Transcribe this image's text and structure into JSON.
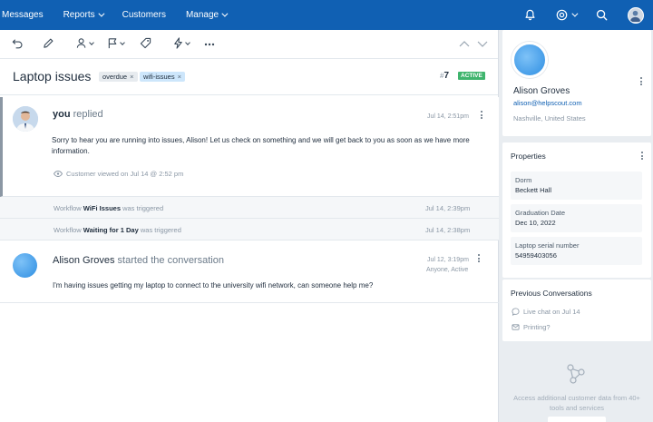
{
  "nav": {
    "items": [
      {
        "label": "Messages",
        "caret": false
      },
      {
        "label": "Reports",
        "caret": true
      },
      {
        "label": "Customers",
        "caret": false
      },
      {
        "label": "Manage",
        "caret": true
      }
    ],
    "icons": [
      "bell-icon",
      "lifebuoy-icon",
      "search-icon",
      "user-avatar"
    ]
  },
  "conversation": {
    "subject": "Laptop issues",
    "tags": [
      "overdue",
      "wifi-issues"
    ],
    "number_prefix": "#",
    "number": "7",
    "status": "ACTIVE"
  },
  "reply": {
    "author": "you",
    "verb": "replied",
    "time": "Jul 14, 2:51pm",
    "body": "Sorry to hear you are running into issues, Alison! Let us check on something and we will get back to you as soon as we have more information.",
    "viewed": "Customer viewed on Jul 14 @ 2:52 pm"
  },
  "workflows": [
    {
      "prefix": "Workflow",
      "name": "WiFi Issues",
      "suffix": "was triggered",
      "time": "Jul 14, 2:39pm"
    },
    {
      "prefix": "Workflow",
      "name": "Waiting for 1 Day",
      "suffix": "was triggered",
      "time": "Jul 14, 2:38pm"
    }
  ],
  "customer_message": {
    "author": "Alison Groves",
    "verb": "started the conversation",
    "time": "Jul 12, 3:19pm",
    "meta": "Anyone, Active",
    "body": "I'm having issues getting my laptop to connect to the university wifi network, can someone help me?"
  },
  "customer": {
    "name": "Alison Groves",
    "email": "alison@helpscout.com",
    "location": "Nashville, United States"
  },
  "properties": {
    "title": "Properties",
    "items": [
      {
        "label": "Dorm",
        "value": "Beckett Hall"
      },
      {
        "label": "Graduation Date",
        "value": "Dec 10, 2022"
      },
      {
        "label": "Laptop serial number",
        "value": "54959403056"
      }
    ]
  },
  "previous": {
    "title": "Previous Conversations",
    "items": [
      {
        "label": "Live chat on Jul 14",
        "icon": "chat-bubble-icon"
      },
      {
        "label": "Printing?",
        "icon": "email-icon"
      }
    ]
  },
  "apps": {
    "text": "Access additional customer data from 40+ tools and services"
  },
  "colors": {
    "nav": "#1060b3",
    "active": "#3fb46d",
    "link": "#1060b3"
  }
}
